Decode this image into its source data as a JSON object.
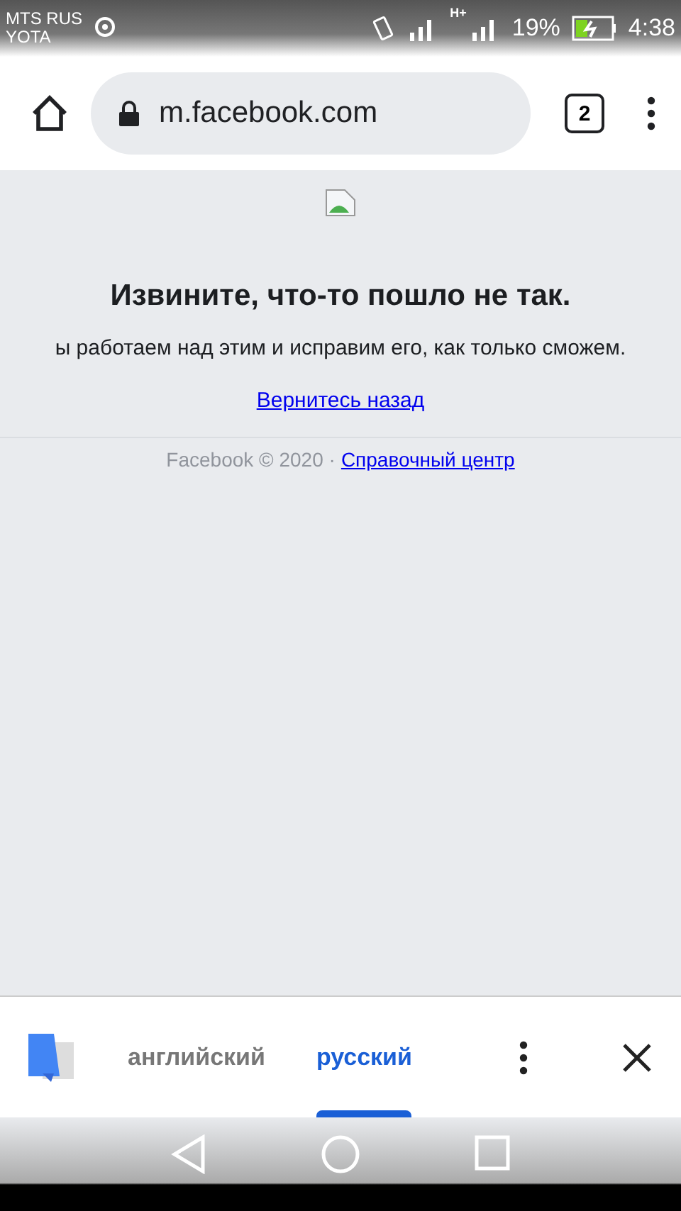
{
  "status_bar": {
    "carriers": [
      "MTS RUS",
      "YOTA"
    ],
    "network_type": "H+",
    "battery": "19%",
    "time": "4:38"
  },
  "browser": {
    "url": "m.facebook.com",
    "tab_count": "2"
  },
  "page": {
    "heading": "Извините, что-то пошло не так.",
    "message": "ы работаем над этим и исправим его, как только сможем.",
    "back_link": "Вернитесь назад",
    "footer_text": "Facebook © 2020 ·",
    "help_link": "Справочный центр"
  },
  "translate_bar": {
    "languages": [
      {
        "label": "английский",
        "selected": false
      },
      {
        "label": "русский",
        "selected": true
      }
    ]
  }
}
